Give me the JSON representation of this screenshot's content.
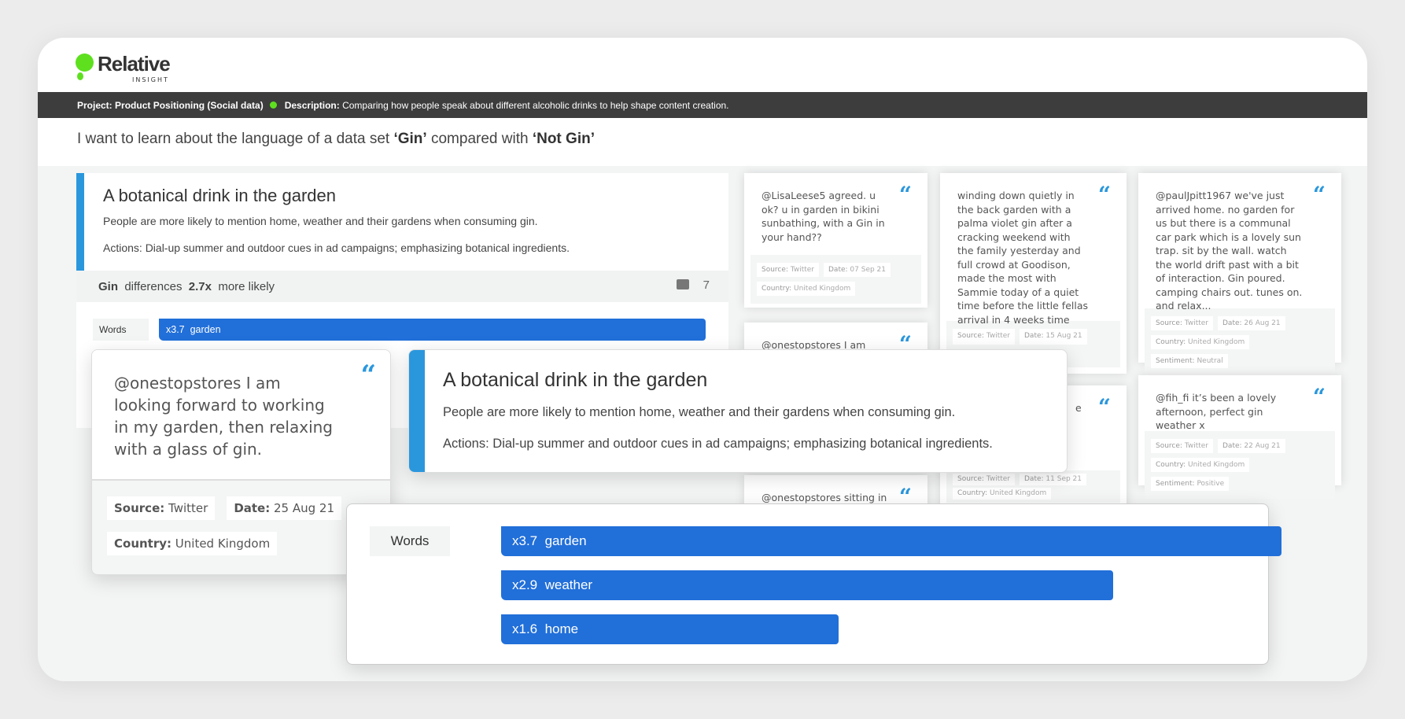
{
  "brand": {
    "name": "Relative",
    "sub": "INSIGHT",
    "accent": "#5ee01f",
    "blue": "#216fd9"
  },
  "project": {
    "label": "Project:",
    "value": "Product Positioning (Social data)",
    "desc_label": "Description:",
    "desc": "Comparing how people speak about different alcoholic drinks to help shape content creation."
  },
  "question": {
    "prefix": "I want to learn about the language of a data set ",
    "a": "‘Gin’",
    "mid": " compared with ",
    "b": "‘Not Gin’"
  },
  "insight": {
    "title": "A botanical drink in the garden",
    "desc": "People are more likely to mention home, weather and their gardens when consuming gin.",
    "actions": "Actions: Dial-up summer and outdoor cues in ad campaigns; emphasizing botanical ingredients."
  },
  "differences": {
    "set": "Gin",
    "label": "differences",
    "factor": "2.7x",
    "suffix": "more likely",
    "count": "7"
  },
  "words": {
    "label": "Words",
    "items": [
      {
        "factor": "x3.7",
        "word": "garden",
        "value": 3.7
      },
      {
        "factor": "x2.9",
        "word": "weather",
        "value": 2.9
      },
      {
        "factor": "x1.6",
        "word": "home",
        "value": 1.6
      }
    ]
  },
  "featured_tweet": {
    "text": "@onestopstores I am looking forward to working in my garden, then relaxing with a glass of gin.",
    "source_label": "Source:",
    "source": "Twitter",
    "date_label": "Date:",
    "date": "25 Aug 21",
    "country_label": "Country:",
    "country": "United Kingdom"
  },
  "tweets": [
    {
      "text": "@LisaLeese5       agreed. u ok? u in garden in bikini sunbathing, with a Gin in your hand??",
      "source": "Twitter",
      "date": "07 Sep 21",
      "country": "United Kingdom"
    },
    {
      "text": "@onestopstores I am looking"
    },
    {
      "text": "@onestopstores sitting in the"
    },
    {
      "text": "winding down quietly in the back garden with a palma violet gin after a cracking weekend with the family yesterday and full crowd at Goodison, made the most with Sammie today of a quiet time before the little fellas arrival in 4 weeks time",
      "source": "Twitter",
      "date": "15 Aug 21"
    },
    {
      "text": "e a ly",
      "source": "Twitter",
      "date": "11 Sep 21",
      "country": "United Kingdom"
    },
    {
      "text": "@paulJpitt1967 we've just arrived home. no garden for us but there is a communal car park which is a lovely sun trap. sit by the wall. watch the world drift past with a bit of interaction. Gin poured. camping chairs out. tunes on. and relax...",
      "source": "Twitter",
      "date": "26 Aug 21",
      "country": "United Kingdom",
      "sentiment": "Neutral"
    },
    {
      "text": "@fih_fi it’s been a lovely afternoon, perfect gin weather x",
      "source": "Twitter",
      "date": "22 Aug 21",
      "country": "United Kingdom",
      "sentiment": "Positive"
    }
  ],
  "meta_labels": {
    "source": "Source:",
    "date": "Date:",
    "country": "Country:",
    "sentiment": "Sentiment:"
  },
  "icons": {
    "quote": "“",
    "comments": "comments-icon"
  }
}
